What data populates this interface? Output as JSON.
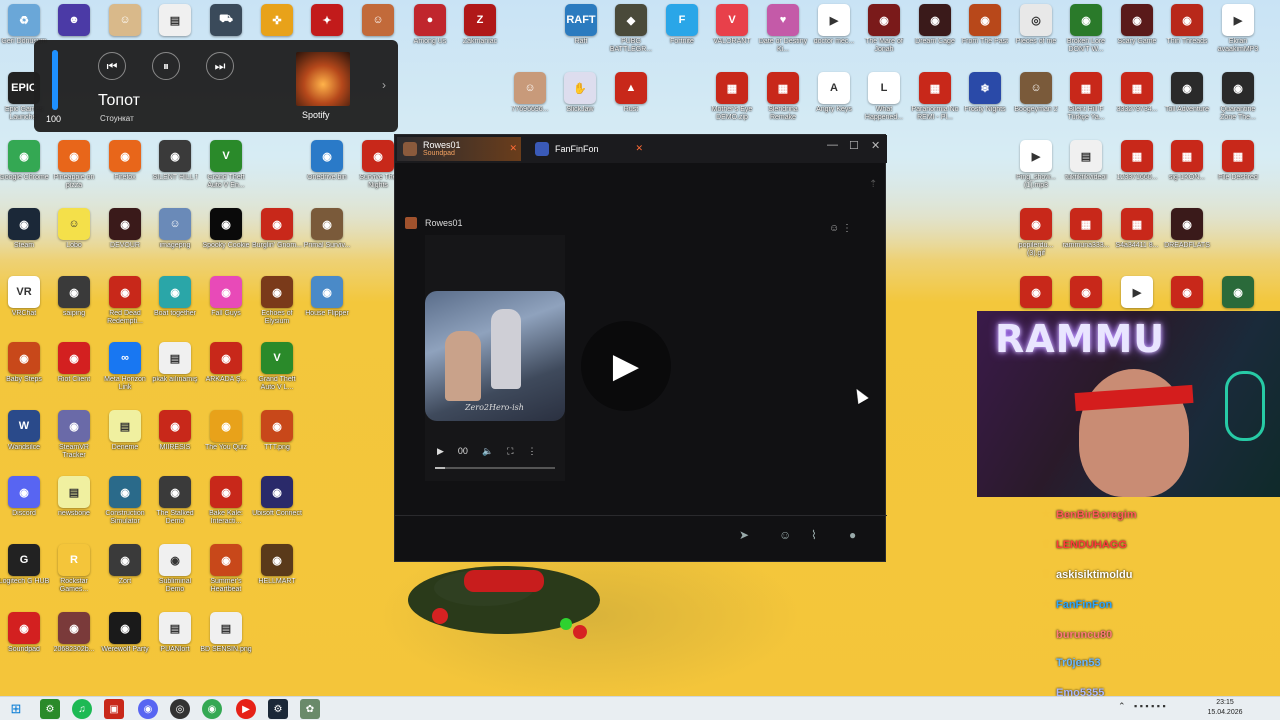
{
  "desktop_icons": [
    {
      "label": "Geri Dönüşüm",
      "color": "#6aa7d8",
      "glyph": "♻"
    },
    {
      "label": "",
      "color": "#4b3aa6",
      "glyph": "☻"
    },
    {
      "label": "",
      "color": "#d9b98a",
      "glyph": "☺"
    },
    {
      "label": "",
      "color": "#f0f0f0",
      "glyph": "▤"
    },
    {
      "label": "",
      "color": "#3a4a5a",
      "glyph": "⛟"
    },
    {
      "label": "",
      "color": "#e8a21a",
      "glyph": "✜"
    },
    {
      "label": "",
      "color": "#c21b1b",
      "glyph": "✦"
    },
    {
      "label": "",
      "color": "#c26a3a",
      "glyph": "☺"
    },
    {
      "label": "Among Us",
      "color": "#c0262d",
      "glyph": "●"
    },
    {
      "label": "Zakmaniac",
      "color": "#b01818",
      "glyph": "Z"
    },
    {
      "label": "Raft",
      "color": "#2b7bbf",
      "glyph": "RAFT"
    },
    {
      "label": "PUBG BATTLEGR...",
      "color": "#4a4a3a",
      "glyph": "◆"
    },
    {
      "label": "Fortnite",
      "color": "#2aa6e8",
      "glyph": "F"
    },
    {
      "label": "VALORANT",
      "color": "#e8404a",
      "glyph": "V"
    },
    {
      "label": "Date or Destiny Ki...",
      "color": "#c45aa8",
      "glyph": "♥"
    },
    {
      "label": "doctor mec...",
      "color": "#ffffff",
      "glyph": "▶"
    },
    {
      "label": "The Mare of Jonah",
      "color": "#7a1a1a",
      "glyph": "◉"
    },
    {
      "label": "Dream Cage",
      "color": "#3a1a1a",
      "glyph": "◉"
    },
    {
      "label": "From The Past",
      "color": "#b8481a",
      "glyph": "◉"
    },
    {
      "label": "Pieces of me",
      "color": "#e8e8e8",
      "glyph": "◎"
    },
    {
      "label": "Broken Lore DON'T W...",
      "color": "#2a7a2a",
      "glyph": "◉"
    },
    {
      "label": "Scary Game",
      "color": "#5a1a1a",
      "glyph": "◉"
    },
    {
      "label": "Thin Threads",
      "color": "#b8281a",
      "glyph": "◉"
    },
    {
      "label": "Ekran avaakimMP3",
      "color": "#ffffff",
      "glyph": "▶"
    },
    {
      "label": "Epic Games Launcher",
      "color": "#222222",
      "glyph": "EPIC"
    },
    {
      "label": "",
      "color": "#d33",
      "glyph": "▥"
    },
    {
      "label": "77696696...",
      "color": "#c89a7a",
      "glyph": "☺"
    },
    {
      "label": "SlickJaw",
      "color": "#dde",
      "glyph": "✋"
    },
    {
      "label": "Rust",
      "color": "#c8281a",
      "glyph": "▲"
    },
    {
      "label": "Mother's Eye DEMO.zip",
      "color": "#c8281a",
      "glyph": "▦"
    },
    {
      "label": "Slendrina Remake",
      "color": "#c8281a",
      "glyph": "▦"
    },
    {
      "label": "Angry Keys",
      "color": "#ffffff",
      "glyph": "A"
    },
    {
      "label": "What Happened...",
      "color": "#ffffff",
      "glyph": "L"
    },
    {
      "label": "Paranormia No REMI - Pl...",
      "color": "#c8281a",
      "glyph": "▦"
    },
    {
      "label": "Frosty Nights",
      "color": "#2a4aa8",
      "glyph": "❄"
    },
    {
      "label": "Boogeyman 2",
      "color": "#7a5a3a",
      "glyph": "☺"
    },
    {
      "label": "Silent Hill F Türkçe Ya...",
      "color": "#c8281a",
      "glyph": "▦"
    },
    {
      "label": "333279734...",
      "color": "#c8281a",
      "glyph": "▦"
    },
    {
      "label": "Toll Adventure",
      "color": "#2a2a2a",
      "glyph": "◉"
    },
    {
      "label": "Quarantine Zone The...",
      "color": "#2a2a2a",
      "glyph": "◉"
    },
    {
      "label": "Google Chrome",
      "color": "#34a853",
      "glyph": "◉"
    },
    {
      "label": "Pineapple on pizza",
      "color": "#e8661a",
      "glyph": "◉"
    },
    {
      "label": "Firefox",
      "color": "#e8661a",
      "glyph": "◉"
    },
    {
      "label": "SILENT HILL f",
      "color": "#3a3a3a",
      "glyph": "◉"
    },
    {
      "label": "Grand Theft Auto V En...",
      "color": "#2a8a2a",
      "glyph": "V"
    },
    {
      "label": "Onedrive.bin",
      "color": "#2a7ac8",
      "glyph": "◉"
    },
    {
      "label": "Survive The Nights",
      "color": "#c8281a",
      "glyph": "◉"
    },
    {
      "label": "Ping_show... (1).mp3",
      "color": "#ffffff",
      "glyph": "▶"
    },
    {
      "label": "tüktiktikvideol",
      "color": "#f0f0f0",
      "glyph": "▤"
    },
    {
      "label": "123371660...",
      "color": "#c8281a",
      "glyph": "▦"
    },
    {
      "label": "sig-1KON...",
      "color": "#c8281a",
      "glyph": "▦"
    },
    {
      "label": "File Deshred",
      "color": "#c8281a",
      "glyph": "▦"
    },
    {
      "label": "Steam",
      "color": "#1b2838",
      "glyph": "◉"
    },
    {
      "label": "Lobo",
      "color": "#f4e04a",
      "glyph": "☺"
    },
    {
      "label": "DEVOUR",
      "color": "#3a1a1a",
      "glyph": "◉"
    },
    {
      "label": "imagepng",
      "color": "#6a8ab8",
      "glyph": "☺"
    },
    {
      "label": "Spooky Cookie",
      "color": "#0a0a0a",
      "glyph": "◉"
    },
    {
      "label": "Burglin' Gnom...",
      "color": "#c8281a",
      "glyph": "◉"
    },
    {
      "label": "Primal Surviv...",
      "color": "#7a5a3a",
      "glyph": "◉"
    },
    {
      "label": "popilerdu... (3).gif",
      "color": "#c8281a",
      "glyph": "◉"
    },
    {
      "label": "rammuna333...",
      "color": "#c8281a",
      "glyph": "▦"
    },
    {
      "label": "S4a34411 8...",
      "color": "#c8281a",
      "glyph": "▦"
    },
    {
      "label": "DREADFLATS",
      "color": "#3a1a1a",
      "glyph": "◉"
    },
    {
      "label": "VRChat",
      "color": "#ffffff",
      "glyph": "VR"
    },
    {
      "label": "saiping",
      "color": "#3a3a3a",
      "glyph": "◉"
    },
    {
      "label": "Red Dead Redempti...",
      "color": "#c8281a",
      "glyph": "◉"
    },
    {
      "label": "Boat together",
      "color": "#2aa6a8",
      "glyph": "◉"
    },
    {
      "label": "Fall Guys",
      "color": "#e84ab8",
      "glyph": "◉"
    },
    {
      "label": "Echoes of Elysium",
      "color": "#7a3a1a",
      "glyph": "◉"
    },
    {
      "label": "House Flipper",
      "color": "#4a8ac8",
      "glyph": "◉"
    },
    {
      "label": "",
      "color": "#c8281a",
      "glyph": "◉"
    },
    {
      "label": "",
      "color": "#c8281a",
      "glyph": "◉"
    },
    {
      "label": "",
      "color": "#ffffff",
      "glyph": "▶"
    },
    {
      "label": "",
      "color": "#c8281a",
      "glyph": "◉"
    },
    {
      "label": "",
      "color": "#2a6a3a",
      "glyph": "◉"
    },
    {
      "label": "Baby Steps",
      "color": "#c8481a",
      "glyph": "◉"
    },
    {
      "label": "Riot Client",
      "color": "#d32020",
      "glyph": "◉"
    },
    {
      "label": "Meta Horizon Link",
      "color": "#1877f2",
      "glyph": "∞"
    },
    {
      "label": "pkak aılınamış",
      "color": "#f0f0f0",
      "glyph": "▤"
    },
    {
      "label": "ARKADA Ş...",
      "color": "#c8281a",
      "glyph": "◉"
    },
    {
      "label": "Grand Theft Auto V L...",
      "color": "#2a8a2a",
      "glyph": "V"
    },
    {
      "label": "Wandsilce",
      "color": "#2a4a8a",
      "glyph": "W"
    },
    {
      "label": "SteamVR Tracker",
      "color": "#6a6aa8",
      "glyph": "◉"
    },
    {
      "label": "Deneme",
      "color": "#f0f0a0",
      "glyph": "▤"
    },
    {
      "label": "MIIRESIS",
      "color": "#c8281a",
      "glyph": "◉"
    },
    {
      "label": "The You Quiz",
      "color": "#e8a21a",
      "glyph": "◉"
    },
    {
      "label": "TTT.png",
      "color": "#c8481a",
      "glyph": "◉"
    },
    {
      "label": "Discord",
      "color": "#5865f2",
      "glyph": "◉"
    },
    {
      "label": "newsbone",
      "color": "#f0f0a0",
      "glyph": "▤"
    },
    {
      "label": "Construction Simulator",
      "color": "#2a6a8a",
      "glyph": "◉"
    },
    {
      "label": "The Stalked Demo",
      "color": "#3a3a3a",
      "glyph": "◉"
    },
    {
      "label": "Bake Kale: Interacti...",
      "color": "#c8281a",
      "glyph": "◉"
    },
    {
      "label": "Ubisoft Connect",
      "color": "#2a2a6a",
      "glyph": "◉"
    },
    {
      "label": "Logitech G HUB",
      "color": "#222222",
      "glyph": "G"
    },
    {
      "label": "Rockstar Games...",
      "color": "#f4c53a",
      "glyph": "R"
    },
    {
      "label": "Zort",
      "color": "#3a3a3a",
      "glyph": "◉"
    },
    {
      "label": "Subliminal Demo",
      "color": "#f0f0f0",
      "glyph": "◉"
    },
    {
      "label": "Summer's Heartbeat",
      "color": "#c8481a",
      "glyph": "◉"
    },
    {
      "label": "HELLMART",
      "color": "#5a3a1a",
      "glyph": "◉"
    },
    {
      "label": "Soundpad",
      "color": "#d32020",
      "glyph": "◉"
    },
    {
      "label": "20682302b...",
      "color": "#7a3a3a",
      "glyph": "◉"
    },
    {
      "label": "Werewolf Party",
      "color": "#1a1a1a",
      "glyph": "◉"
    },
    {
      "label": "PUANlort",
      "color": "#f0f0f0",
      "glyph": "▤"
    },
    {
      "label": "BD SENSIN.png",
      "color": "#f0f0f0",
      "glyph": "▤"
    }
  ],
  "media": {
    "title": "Топот",
    "artist": "Стоункат",
    "volume": "100",
    "volume_fraction": 1.0,
    "source": "Spotify",
    "prev_icon": "skip-back-icon",
    "pause_icon": "pause-icon",
    "next_icon": "skip-forward-icon"
  },
  "chat_window": {
    "tabs": [
      {
        "name": "Rowes01",
        "subtitle": "Soundpad",
        "active": true
      },
      {
        "name": "FanFinFon",
        "subtitle": "",
        "active": false
      }
    ],
    "message": {
      "author": "Rowes01",
      "video_watermark": "Zero2Hero-ish",
      "video_time": "00"
    },
    "controls": {
      "minimize": "—",
      "maximize": "☐",
      "close": "✕"
    }
  },
  "webcam": {
    "sign_text": "RAMMU"
  },
  "chat_overlay": [
    {
      "nick": "BenBirBoregim",
      "color": "#ff5a5a",
      "badge": "★"
    },
    {
      "nick": "LENDUHAGG",
      "color": "#ff3a3a",
      "badge": "♛"
    },
    {
      "nick": "askisiktimoldu",
      "color": "#ffffff",
      "badge": "♛"
    },
    {
      "nick": "FanFinFon",
      "color": "#2aa6ff",
      "badge": "★"
    },
    {
      "nick": "buruncu80",
      "color": "#ff7a7a",
      "badge": "♛"
    },
    {
      "nick": "Tr0jen53",
      "color": "#6ab8ff",
      "badge": "◆"
    },
    {
      "nick": "Emo5355",
      "color": "#aab8ff",
      "badge": "♛"
    }
  ],
  "taskbar": {
    "time": "23:15",
    "date": "15.04.2026",
    "apps": [
      "windows-start",
      "search",
      "spotify",
      "soundpad",
      "discord",
      "obs",
      "chrome",
      "youtube",
      "steam",
      "misc"
    ]
  }
}
